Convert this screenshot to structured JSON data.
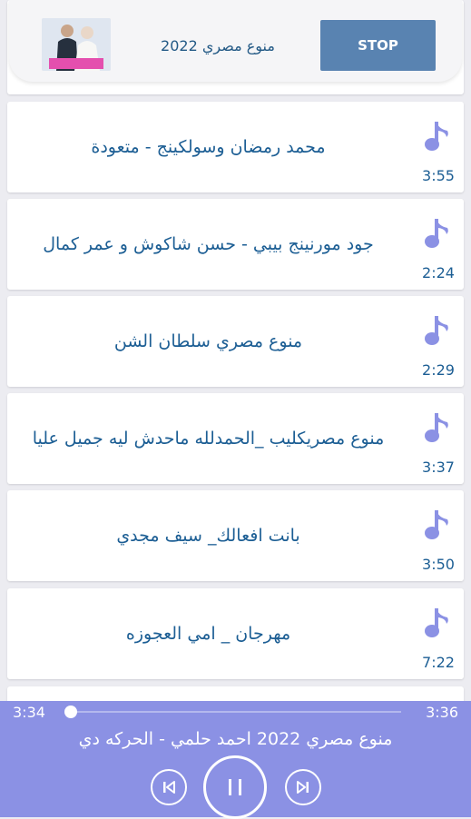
{
  "now_playing_bar": {
    "title": "منوع مصري 2022",
    "stop_label": "STOP"
  },
  "tracks": [
    {
      "title": "محمد رمضان وسولكينج - متعودة",
      "duration": "3:55"
    },
    {
      "title": "جود مورنينج بيبي - حسن شاكوش و عمر كمال",
      "duration": "2:24"
    },
    {
      "title": "منوع مصري سلطان الشن",
      "duration": "2:29"
    },
    {
      "title": "منوع مصريكليب _الحمدلله ماحدش ليه جميل عليا",
      "duration": "3:37"
    },
    {
      "title": "بانت افعالك_ سيف مجدي",
      "duration": "3:50"
    },
    {
      "title": "مهرجان _ امي العجوزه",
      "duration": "7:22"
    }
  ],
  "player": {
    "current_time": "3:34",
    "total_time": "3:36",
    "progress": 0.0,
    "now_playing_title": "منوع مصري 2022 احمد حلمي - الحركه دي"
  },
  "colors": {
    "accent": "#8b91e4",
    "text_blue": "#1c5e94",
    "stop_button": "#5983b1"
  },
  "icons": {
    "track": "music-note-icon",
    "prev": "skip-previous-icon",
    "pause": "pause-icon",
    "next": "skip-next-icon"
  }
}
